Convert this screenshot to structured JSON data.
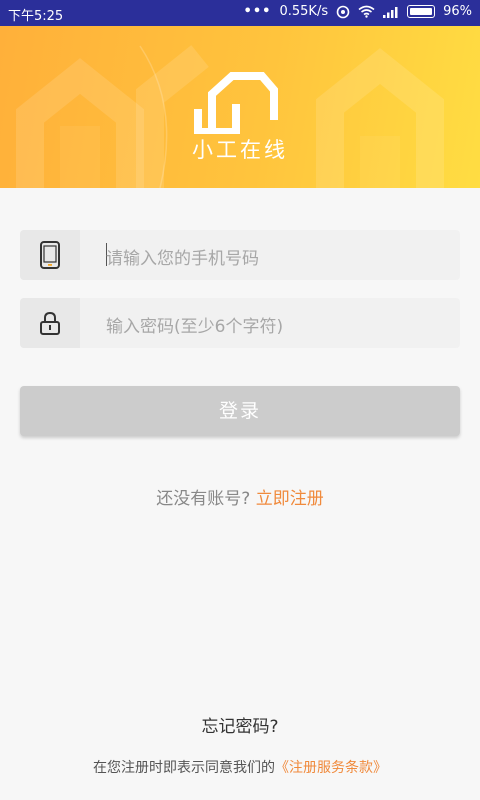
{
  "status_bar": {
    "time": "下午5:25",
    "speed": "0.55K/s",
    "battery": "96%",
    "icons": [
      "more-dots-icon",
      "hotspot-icon",
      "wifi-icon",
      "signal-icon",
      "battery-icon"
    ]
  },
  "banner": {
    "app_name": "小工在线",
    "logo_icon": "house-logo-icon"
  },
  "form": {
    "phone_placeholder": "请输入您的手机号码",
    "phone_icon": "phone-icon",
    "password_placeholder": "输入密码(至少6个字符)",
    "password_icon": "lock-icon",
    "login_label": "登录"
  },
  "register": {
    "prompt": "还没有账号?",
    "link": "立即注册"
  },
  "forgot_password": "忘记密码?",
  "terms": {
    "prefix": "在您注册时即表示同意我们的",
    "link": "《注册服务条款》"
  },
  "colors": {
    "status_bar": "#2b2f9a",
    "banner_start": "#ffb03a",
    "banner_end": "#ffdd42",
    "accent": "#f08a3c",
    "button_disabled": "#cccccc"
  }
}
